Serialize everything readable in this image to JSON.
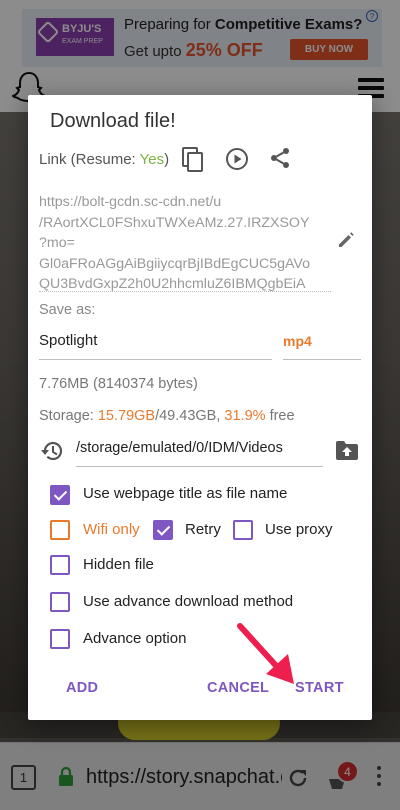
{
  "ad": {
    "logo_title": "BYJU'S",
    "logo_sub": "EXAM PREP",
    "headline_prefix": "Preparing for ",
    "headline_bold": "Competitive Exams?",
    "subline_prefix": "Get upto ",
    "subline_pct": "25% OFF",
    "buy_label": "BUY NOW",
    "info_glyph": "?"
  },
  "dialog": {
    "title": "Download file!",
    "link_label": "Link (Resume: ",
    "resume_value": "Yes",
    "link_label_end": ")",
    "url_lines": [
      "https://bolt-gcdn.sc-cdn.net/u",
      "/RAortXCL0FShxuTWXeAMz.27.IRZXSOY",
      "?mo=",
      "Gl0aFRoAGgAiBgiiycqrBjIBdEgCUC5gAVo",
      "QU3BvdGxpZ2h0U2hhcmluZ6IBMQgbEiA"
    ],
    "save_as_label": "Save as:",
    "filename": "Spotlight",
    "extension": "mp4",
    "size_text": "7.76MB (8140374 bytes)",
    "storage_label": "Storage: ",
    "storage_used": "15.79GB",
    "storage_total": "/49.43GB, ",
    "storage_pct": "31.9%",
    "storage_free": " free",
    "path": "/storage/emulated/0/IDM/Videos",
    "options": {
      "webpage_title": "Use webpage title as file name",
      "wifi_only": "Wifi only",
      "retry": "Retry",
      "use_proxy": "Use proxy",
      "hidden_file": "Hidden file",
      "advance_download": "Use advance download method",
      "advance_option": "Advance option"
    },
    "checked": {
      "webpage_title": true,
      "wifi_only": false,
      "retry": true,
      "use_proxy": false,
      "hidden_file": false,
      "advance_download": false,
      "advance_option": false
    },
    "buttons": {
      "add": "ADD",
      "cancel": "CANCEL",
      "start": "START"
    }
  },
  "browser": {
    "tab_count": "1",
    "url": "https://story.snapchat.com",
    "download_badge": "4"
  },
  "colors": {
    "accent": "#7e57c2",
    "orange": "#e87a2c",
    "resume_green": "#7cb342",
    "badge_red": "#d32f2f",
    "arrow_red": "#ee1f4f"
  }
}
